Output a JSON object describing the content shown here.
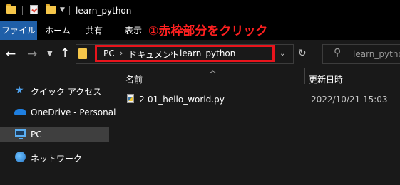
{
  "window": {
    "title": "learn_python"
  },
  "ribbon": {
    "tabs": [
      {
        "label": "ファイル"
      },
      {
        "label": "ホーム"
      },
      {
        "label": "共有"
      },
      {
        "label": "表示"
      }
    ]
  },
  "annotation": {
    "text": "①赤枠部分をクリック",
    "color": "#e8141c"
  },
  "address_bar": {
    "crumbs": [
      "PC",
      "ドキュメント",
      "learn_python"
    ],
    "separator": "›"
  },
  "search": {
    "placeholder": "learn_python"
  },
  "columns": {
    "name": "名前",
    "modified": "更新日時"
  },
  "files": [
    {
      "name": "2-01_hello_world.py",
      "modified": "2022/10/21 15:03",
      "icon": "python-file-icon"
    }
  ],
  "sidebar": {
    "items": [
      {
        "label": "クイック アクセス",
        "icon": "star-icon"
      },
      {
        "label": "OneDrive - Personal",
        "icon": "cloud-icon"
      },
      {
        "label": "PC",
        "icon": "pc-icon",
        "selected": true
      },
      {
        "label": "ネットワーク",
        "icon": "network-icon"
      }
    ]
  },
  "colors": {
    "accent_tab": "#1f5fa8",
    "highlight_border": "#e8141c",
    "background": "#191919"
  }
}
